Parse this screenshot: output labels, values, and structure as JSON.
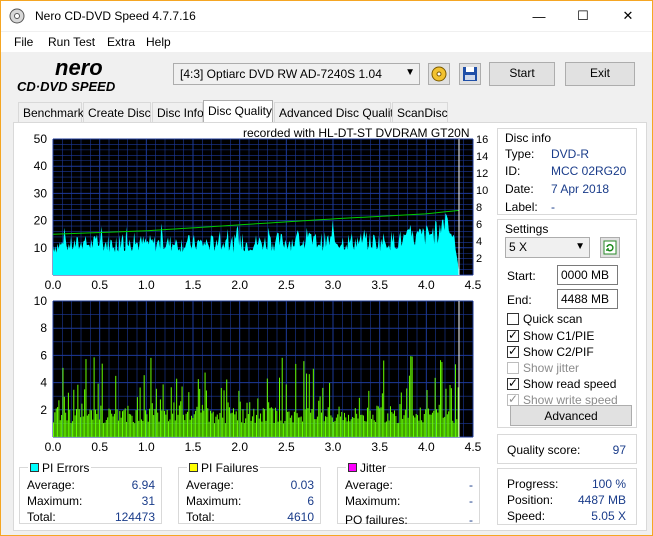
{
  "window": {
    "title": "Nero CD-DVD Speed 4.7.7.16",
    "minimize_glyph": "—",
    "maximize_glyph": "☐",
    "close_glyph": "✕"
  },
  "menu": [
    "File",
    "Run Test",
    "Extra",
    "Help"
  ],
  "toolbar": {
    "logo_top": "nero",
    "logo_bottom": "CD·DVD SPEED",
    "drive": "[4:3]  Optiarc DVD RW AD-7240S 1.04",
    "start_label": "Start",
    "exit_label": "Exit",
    "icons": [
      "eject-icon",
      "save-icon"
    ]
  },
  "tabs": [
    "Benchmark",
    "Create Disc",
    "Disc Info",
    "Disc Quality",
    "Advanced Disc Quality",
    "ScanDisc"
  ],
  "active_tab": "Disc Quality",
  "chart_header": "recorded with HL-DT-ST DVDRAM GT20N",
  "chart_data": [
    {
      "type": "area",
      "name": "pi-errors-chart",
      "x_ticks": [
        "0.0",
        "0.5",
        "1.0",
        "1.5",
        "2.0",
        "2.5",
        "3.0",
        "3.5",
        "4.0",
        "4.5"
      ],
      "y_ticks_left": [
        "50",
        "40",
        "30",
        "20",
        "10"
      ],
      "y_ticks_right": [
        "16",
        "14",
        "12",
        "10",
        "8",
        "6",
        "4",
        "2"
      ],
      "xlim": [
        0,
        4.5
      ],
      "ylim_left": [
        0,
        50
      ],
      "ylim_right": [
        0,
        16
      ],
      "series": [
        {
          "name": "PI Errors",
          "color": "#00ffff",
          "profile_x": [
            0.0,
            0.5,
            1.0,
            1.5,
            2.0,
            2.5,
            3.0,
            3.5,
            3.8,
            4.0,
            4.15,
            4.2,
            4.26,
            4.3,
            4.35
          ],
          "profile_y": [
            14,
            15,
            15,
            15,
            15,
            16,
            16,
            16,
            17,
            19,
            21,
            30,
            22,
            19,
            0
          ]
        },
        {
          "color": "#00cc00",
          "profile_x": [
            0.0,
            1.0,
            2.0,
            3.0,
            4.0,
            4.35
          ],
          "profile_y": [
            4.8,
            5.2,
            5.9,
            6.6,
            7.2,
            7.6
          ]
        }
      ],
      "grid": true
    },
    {
      "type": "bar",
      "name": "pi-failures-chart",
      "x_ticks": [
        "0.0",
        "0.5",
        "1.0",
        "1.5",
        "2.0",
        "2.5",
        "3.0",
        "3.5",
        "4.0",
        "4.5"
      ],
      "y_ticks_left": [
        "10",
        "8",
        "6",
        "4",
        "2"
      ],
      "xlim": [
        0,
        4.5
      ],
      "ylim": [
        0,
        10
      ],
      "series": [
        {
          "name": "PI Failures",
          "color": "#66ff00",
          "typical_max": 6,
          "baseline": 1
        }
      ],
      "grid": true
    }
  ],
  "disc_info": {
    "title": "Disc info",
    "rows": [
      {
        "label": "Type:",
        "value": "DVD-R"
      },
      {
        "label": "ID:",
        "value": "MCC 02RG20"
      },
      {
        "label": "Date:",
        "value": "7 Apr 2018"
      },
      {
        "label": "Label:",
        "value": "-"
      }
    ]
  },
  "settings": {
    "title": "Settings",
    "speed": "5 X",
    "start_label": "Start:",
    "start_value": "0000 MB",
    "end_label": "End:",
    "end_value": "4488 MB",
    "checkboxes": [
      {
        "label": "Quick scan",
        "checked": false,
        "enabled": true
      },
      {
        "label": "Show C1/PIE",
        "checked": true,
        "enabled": true
      },
      {
        "label": "Show C2/PIF",
        "checked": true,
        "enabled": true
      },
      {
        "label": "Show jitter",
        "checked": false,
        "enabled": false
      },
      {
        "label": "Show read speed",
        "checked": true,
        "enabled": true
      },
      {
        "label": "Show write speed",
        "checked": true,
        "enabled": false
      }
    ],
    "advanced_label": "Advanced"
  },
  "quality": {
    "label": "Quality score:",
    "value": "97"
  },
  "progress": {
    "rows": [
      {
        "label": "Progress:",
        "value": "100 %"
      },
      {
        "label": "Position:",
        "value": "4487 MB"
      },
      {
        "label": "Speed:",
        "value": "5.05 X"
      }
    ]
  },
  "stats": {
    "pi_errors": {
      "title": "PI Errors",
      "color": "#00ffff",
      "average_label": "Average:",
      "average": "6.94",
      "maximum_label": "Maximum:",
      "maximum": "31",
      "total_label": "Total:",
      "total": "124473"
    },
    "pi_failures": {
      "title": "PI Failures",
      "color": "#ffff00",
      "average_label": "Average:",
      "average": "0.03",
      "maximum_label": "Maximum:",
      "maximum": "6",
      "total_label": "Total:",
      "total": "4610"
    },
    "jitter": {
      "title": "Jitter",
      "color": "#ff00ff",
      "average_label": "Average:",
      "average": "-",
      "maximum_label": "Maximum:",
      "maximum": "-",
      "po_label": "PO failures:",
      "po": "-"
    }
  }
}
